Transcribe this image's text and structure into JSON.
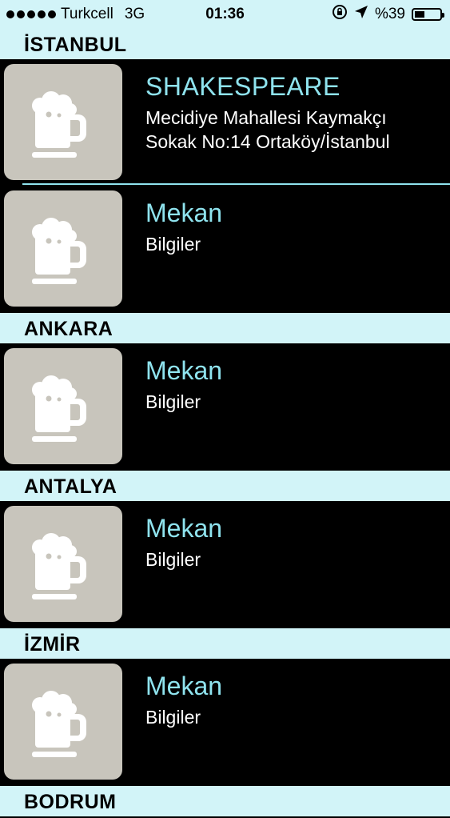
{
  "status_bar": {
    "carrier": "Turkcell",
    "network": "3G",
    "time": "01:36",
    "lock_icon": "rotation-lock-icon",
    "location_icon": "location-arrow-icon",
    "battery_text": "%39",
    "battery_level": 0.39
  },
  "sections": [
    {
      "title": "İSTANBUL",
      "items": [
        {
          "title": "SHAKESPEARE",
          "subtitle": "Mecidiye Mahallesi Kaymakçı\nSokak No:14 Ortaköy/İstanbul"
        },
        {
          "title": "Mekan",
          "subtitle": "Bilgiler"
        }
      ]
    },
    {
      "title": "ANKARA",
      "items": [
        {
          "title": "Mekan",
          "subtitle": "Bilgiler"
        }
      ]
    },
    {
      "title": "ANTALYA",
      "items": [
        {
          "title": "Mekan",
          "subtitle": "Bilgiler"
        }
      ]
    },
    {
      "title": "İZMİR",
      "items": [
        {
          "title": "Mekan",
          "subtitle": "Bilgiler"
        }
      ]
    },
    {
      "title": "BODRUM",
      "items": []
    }
  ],
  "colors": {
    "header_bg": "#d2f4f8",
    "accent": "#8fe3ee",
    "thumb_bg": "#c8c5bc",
    "row_bg": "#000000"
  },
  "icons": {
    "thumbnail": "beer-mug-icon"
  }
}
